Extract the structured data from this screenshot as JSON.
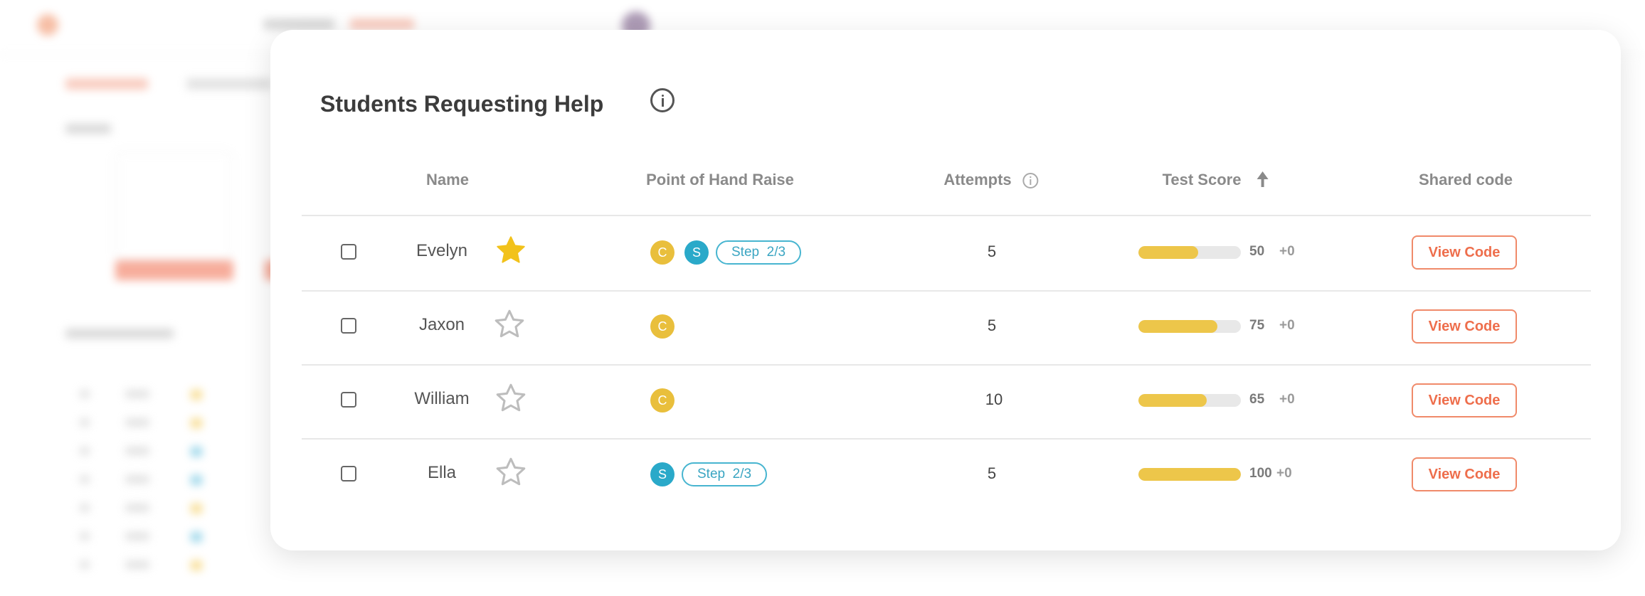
{
  "modal": {
    "title": "Students Requesting Help",
    "title_icon": "info-icon",
    "columns": {
      "name": "Name",
      "hand_raise": "Point of Hand Raise",
      "attempts": "Attempts",
      "attempts_icon": "info-icon",
      "test_score": "Test Score",
      "test_score_icon": "sort-ascending-icon",
      "shared_code": "Shared code"
    },
    "rows": [
      {
        "checked": false,
        "name": "Evelyn",
        "starred": true,
        "hand_raise_badges": [
          "C",
          "S"
        ],
        "step": "Step  2/3",
        "attempts": "5",
        "score_percent": 58,
        "score": "50",
        "delta": "+0",
        "action": "View Code"
      },
      {
        "checked": false,
        "name": "Jaxon",
        "starred": false,
        "hand_raise_badges": [
          "C"
        ],
        "step": "",
        "attempts": "5",
        "score_percent": 77,
        "score": "75",
        "delta": "+0",
        "action": "View Code"
      },
      {
        "checked": false,
        "name": "William",
        "starred": false,
        "hand_raise_badges": [
          "C"
        ],
        "step": "",
        "attempts": "10",
        "score_percent": 67,
        "score": "65",
        "delta": "+0",
        "action": "View Code"
      },
      {
        "checked": false,
        "name": "Ella",
        "starred": false,
        "hand_raise_badges": [
          "S"
        ],
        "step": "Step  2/3",
        "attempts": "5",
        "score_percent": 100,
        "score": "100",
        "delta": "+0",
        "action": "View Code"
      }
    ]
  },
  "colors": {
    "accent": "#ee6e4c",
    "badge_c": "#e9bf3c",
    "badge_s": "#2aa9c9",
    "score_bar": "#edc64a",
    "star_filled": "#f2c21b",
    "star_empty": "#bdbdbd"
  }
}
